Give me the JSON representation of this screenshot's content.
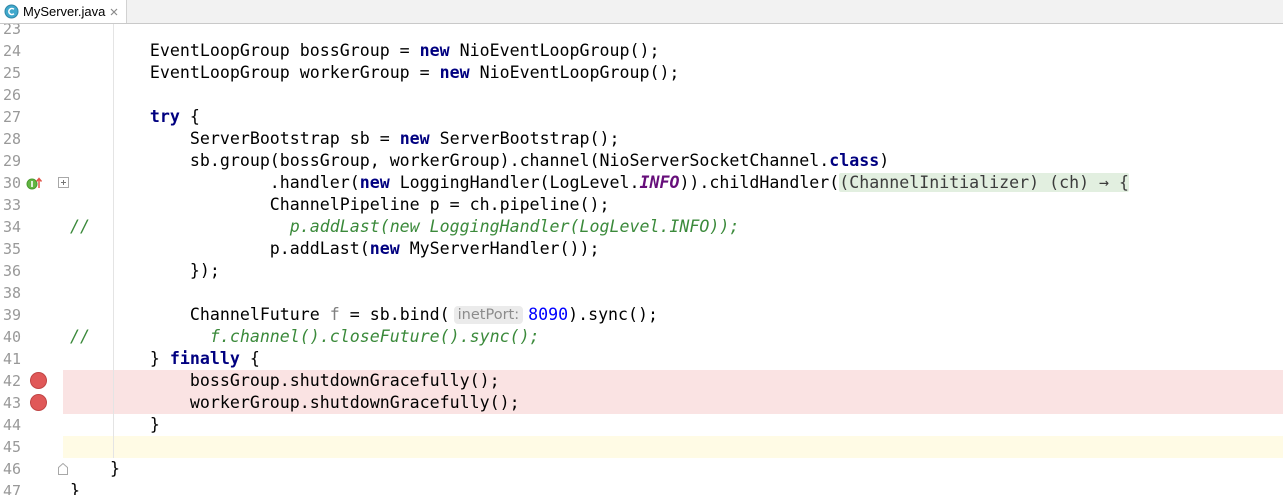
{
  "tab": {
    "title": "MyServer.java",
    "icon": "java-class-icon",
    "close_icon": "close-icon"
  },
  "theme": {
    "keyword": "#000080",
    "constant": "#660e7a",
    "number": "#0000ff",
    "comment": "#3b8a3b",
    "breakpoint": "#e05858",
    "breakpoint_row": "#fae3e3",
    "current_row": "#fffbe5",
    "folded_bg": "#e2efe0"
  },
  "editor": {
    "lines": [
      {
        "number": "23",
        "tokens": []
      },
      {
        "number": "24",
        "tokens": [
          {
            "text": "        EventLoopGroup bossGroup = "
          },
          {
            "text": "new",
            "keyword": true
          },
          {
            "text": " NioEventLoopGroup();"
          }
        ]
      },
      {
        "number": "25",
        "tokens": [
          {
            "text": "        EventLoopGroup workerGroup = "
          },
          {
            "text": "new",
            "keyword": true
          },
          {
            "text": " NioEventLoopGroup();"
          }
        ]
      },
      {
        "number": "26",
        "tokens": []
      },
      {
        "number": "27",
        "tokens": [
          {
            "text": "        try",
            "keyword": true
          },
          {
            "text": " {"
          }
        ]
      },
      {
        "number": "28",
        "tokens": [
          {
            "text": "            ServerBootstrap sb = "
          },
          {
            "text": "new",
            "keyword": true
          },
          {
            "text": " ServerBootstrap();"
          }
        ]
      },
      {
        "number": "29",
        "tokens": [
          {
            "text": "            sb.group(bossGroup, workerGroup).channel(NioServerSocketChannel."
          },
          {
            "text": "class",
            "keyword": true
          },
          {
            "text": ")"
          }
        ]
      },
      {
        "number": "30",
        "gutter_icon": "implements-method-icon",
        "fold_marker": "fold-expand-icon",
        "tokens": [
          {
            "text": "                    .handler("
          },
          {
            "text": "new",
            "keyword": true
          },
          {
            "text": " LoggingHandler(LogLevel."
          },
          {
            "text": "INFO",
            "constant": true
          },
          {
            "text": ")).childHandler("
          },
          {
            "text": "(ChannelInitializer) (ch) → {",
            "folded": true
          }
        ]
      },
      {
        "number": "33",
        "tokens": [
          {
            "text": "                    ChannelPipeline p = ch.pipeline();"
          }
        ]
      },
      {
        "number": "34",
        "tokens": [
          {
            "text": "//                    p.addLast(new LoggingHandler(LogLevel.INFO));",
            "comment": true
          }
        ]
      },
      {
        "number": "35",
        "tokens": [
          {
            "text": "                    p.addLast("
          },
          {
            "text": "new",
            "keyword": true
          },
          {
            "text": " MyServerHandler());"
          }
        ]
      },
      {
        "number": "36",
        "tokens": [
          {
            "text": "            });"
          }
        ]
      },
      {
        "number": "38",
        "tokens": []
      },
      {
        "number": "39",
        "tokens": [
          {
            "text": "            ChannelFuture "
          },
          {
            "text": "f",
            "unused": true
          },
          {
            "text": " = sb.bind("
          },
          {
            "text": "inetPort:",
            "param_hint": true
          },
          {
            "text": "8090",
            "numeric": true
          },
          {
            "text": ").sync();"
          }
        ]
      },
      {
        "number": "40",
        "tokens": [
          {
            "text": "//            f.channel().closeFuture().sync();",
            "comment": true
          }
        ]
      },
      {
        "number": "41",
        "tokens": [
          {
            "text": "        } "
          },
          {
            "text": "finally",
            "keyword": true
          },
          {
            "text": " {"
          }
        ]
      },
      {
        "number": "42",
        "breakpoint": true,
        "tokens": [
          {
            "text": "            bossGroup.shutdownGracefully();"
          }
        ]
      },
      {
        "number": "43",
        "breakpoint": true,
        "tokens": [
          {
            "text": "            workerGroup.shutdownGracefully();"
          }
        ]
      },
      {
        "number": "44",
        "tokens": [
          {
            "text": "        }"
          }
        ]
      },
      {
        "number": "45",
        "current": true,
        "tokens": []
      },
      {
        "number": "46",
        "fold_marker": "fold-end-icon",
        "tokens": [
          {
            "text": "    }"
          }
        ]
      },
      {
        "number": "47",
        "tokens": [
          {
            "text": "}"
          }
        ]
      }
    ]
  }
}
